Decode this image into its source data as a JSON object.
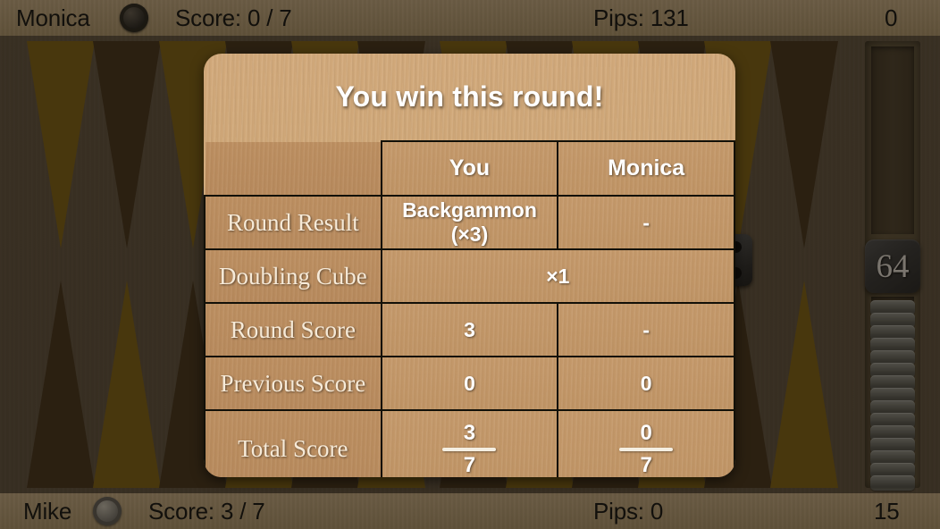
{
  "top_bar": {
    "player_name": "Monica",
    "checker_icon": "dark-checker-icon",
    "score": "Score: 0 / 7",
    "pips": "Pips: 131",
    "borne_off": "0"
  },
  "bottom_bar": {
    "player_name": "Mike",
    "checker_icon": "light-checker-icon",
    "score": "Score: 3 / 7",
    "pips": "Pips: 0",
    "borne_off": "15"
  },
  "doubling_cube_tray": {
    "value": "64"
  },
  "dialog": {
    "title": "You win this round!",
    "columns": [
      "",
      "You",
      "Monica"
    ],
    "rows": [
      {
        "label": "Round Result",
        "you": "Backgammon (×3)",
        "opponent": "-",
        "span": false
      },
      {
        "label": "Doubling Cube",
        "you": "×1",
        "opponent": "",
        "span": true
      },
      {
        "label": "Round Score",
        "you": "3",
        "opponent": "-",
        "span": false
      },
      {
        "label": "Previous Score",
        "you": "0",
        "opponent": "0",
        "span": false
      }
    ],
    "total_row": {
      "label": "Total Score",
      "you_numerator": "3",
      "you_denominator": "7",
      "opponent_numerator": "0",
      "opponent_denominator": "7"
    }
  },
  "colors": {
    "board_felt": "#584b39",
    "point_light": "#7a5c12",
    "point_dark": "#41301a",
    "dialog_wood": "#cfa878",
    "label_wood": "#b88b5e",
    "text_white": "#ffffff",
    "label_cream": "#f6ead8",
    "info_text": "#12100c"
  }
}
